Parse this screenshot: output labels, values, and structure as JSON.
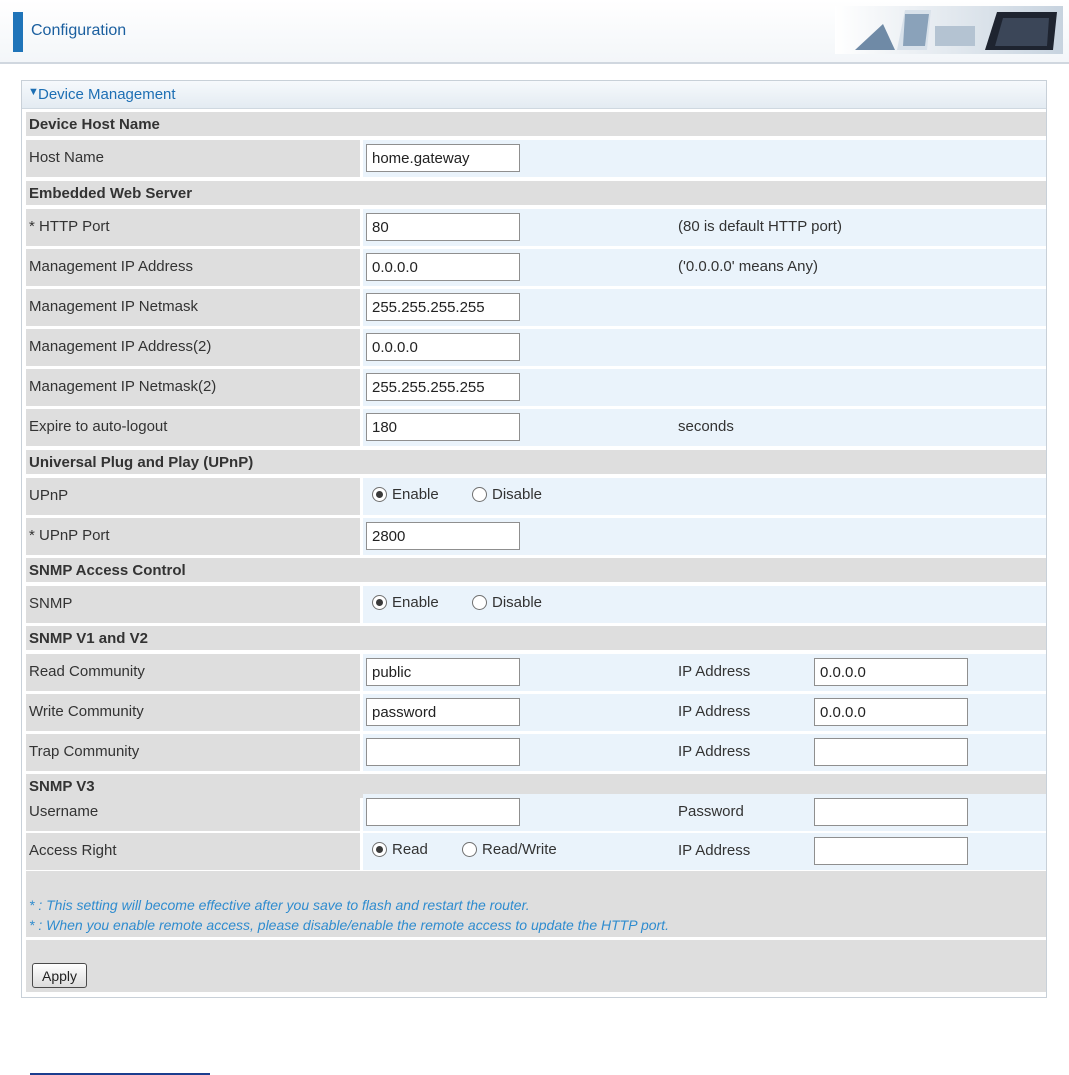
{
  "header": {
    "title": "Configuration"
  },
  "panel": {
    "title": "Device Management"
  },
  "sections": {
    "host": "Device Host Name",
    "web": "Embedded Web Server",
    "upnp": "Universal Plug and Play (UPnP)",
    "snmp": "SNMP Access Control",
    "snmpv12": "SNMP V1 and V2",
    "snmpv3": "SNMP V3"
  },
  "fields": {
    "host_name": {
      "label": "Host Name",
      "value": "home.gateway"
    },
    "http_port": {
      "label": "* HTTP Port",
      "value": "80",
      "hint": "(80 is default HTTP port)"
    },
    "mgmt_ip": {
      "label": "Management IP Address",
      "value": "0.0.0.0",
      "hint": "('0.0.0.0' means Any)"
    },
    "mgmt_mask": {
      "label": "Management IP Netmask",
      "value": "255.255.255.255"
    },
    "mgmt_ip2": {
      "label": "Management IP Address(2)",
      "value": "0.0.0.0"
    },
    "mgmt_mask2": {
      "label": "Management IP Netmask(2)",
      "value": "255.255.255.255"
    },
    "auto_logout": {
      "label": "Expire to auto-logout",
      "value": "180",
      "hint": "seconds"
    },
    "upnp": {
      "label": "UPnP",
      "opt1": "Enable",
      "opt2": "Disable",
      "selected": "Enable"
    },
    "upnp_port": {
      "label": "* UPnP Port",
      "value": "2800"
    },
    "snmp": {
      "label": "SNMP",
      "opt1": "Enable",
      "opt2": "Disable",
      "selected": "Enable"
    },
    "read_comm": {
      "label": "Read Community",
      "value": "public",
      "ip_label": "IP Address",
      "ip_value": "0.0.0.0"
    },
    "write_comm": {
      "label": "Write Community",
      "value": "password",
      "ip_label": "IP Address",
      "ip_value": "0.0.0.0"
    },
    "trap_comm": {
      "label": "Trap Community",
      "value": "",
      "ip_label": "IP Address",
      "ip_value": ""
    },
    "username": {
      "label": "Username",
      "value": "",
      "pw_label": "Password",
      "pw_value": ""
    },
    "access_right": {
      "label": "Access Right",
      "opt1": "Read",
      "opt2": "Read/Write",
      "selected": "Read",
      "ip_label": "IP Address",
      "ip_value": ""
    }
  },
  "notes": {
    "note1": "* : This setting will become effective after you save to flash and restart the router.",
    "note2": "* : When you enable remote access, please disable/enable the remote access to update the HTTP port."
  },
  "buttons": {
    "apply": "Apply"
  },
  "colors": {
    "accent": "#1f74b9",
    "label_bg": "#dedede",
    "value_bg": "#eaf3fb",
    "note_text": "#2f8ccf"
  }
}
